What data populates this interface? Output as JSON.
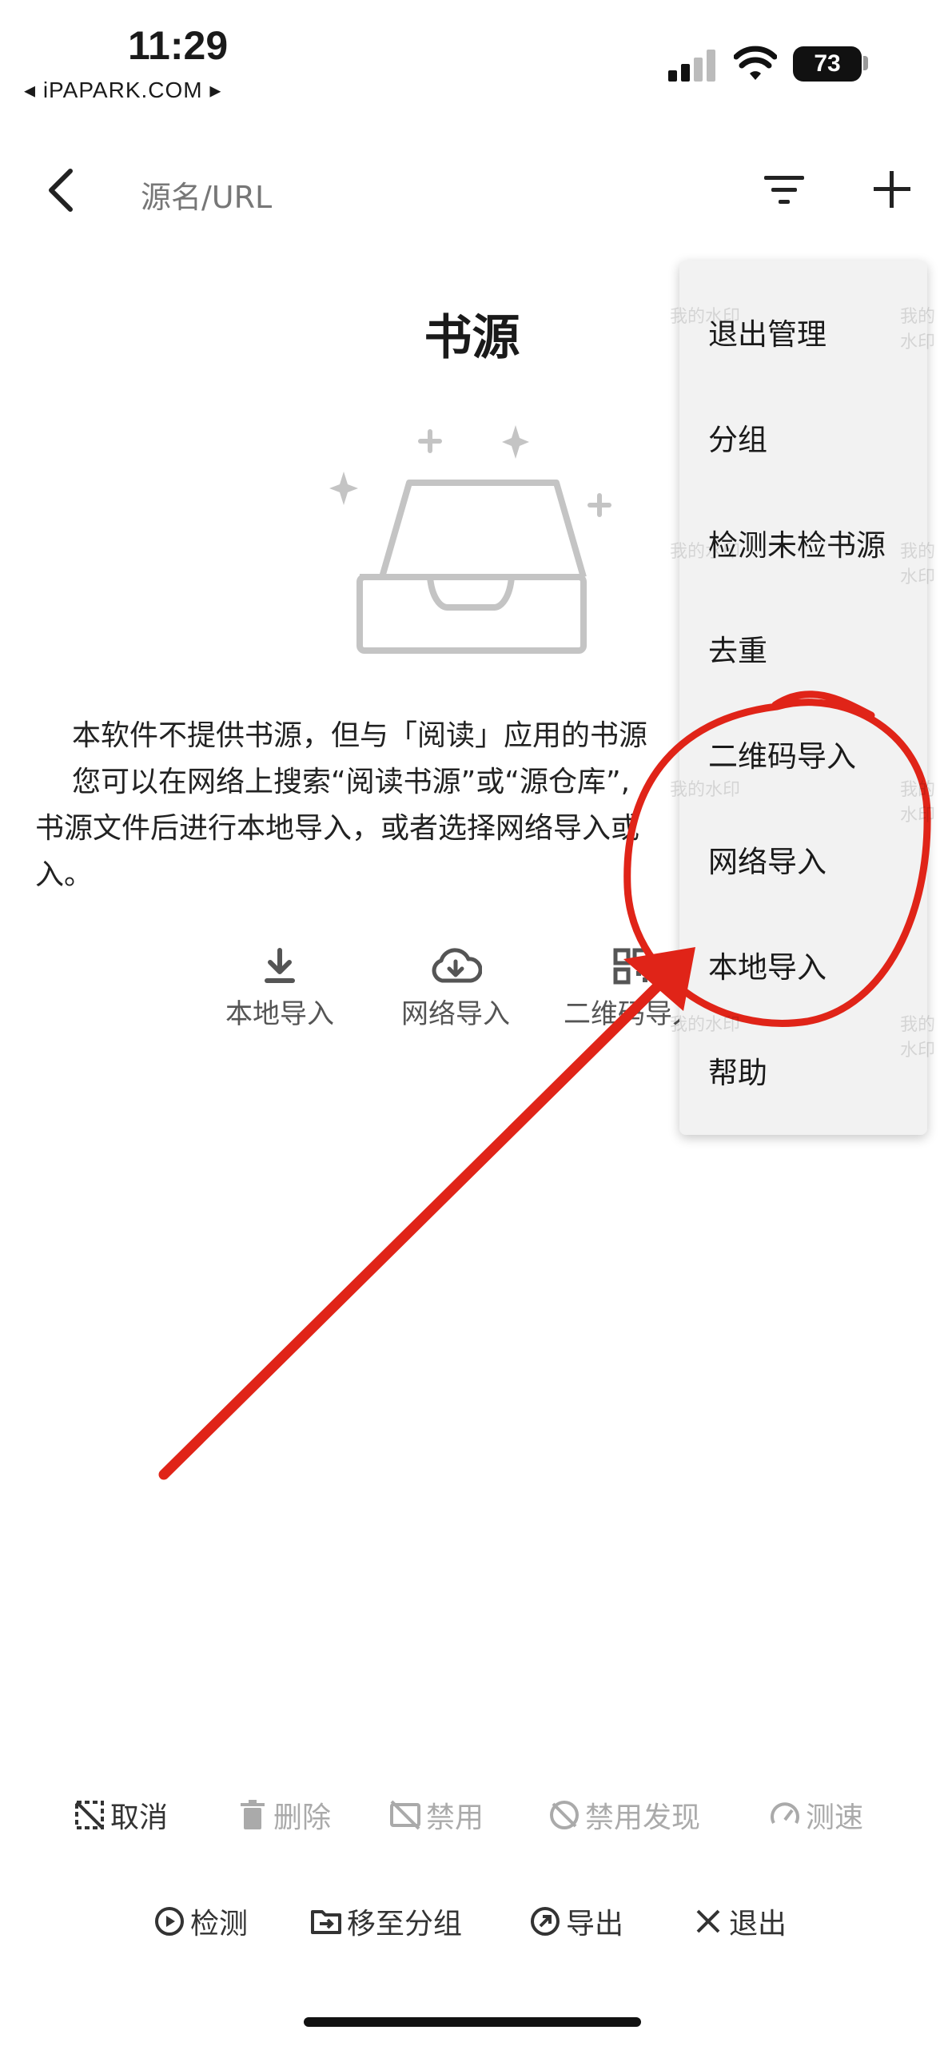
{
  "status_bar": {
    "time": "11:29",
    "carrier": "◂ iPAPARK.COM ▸",
    "battery": "73"
  },
  "top_bar": {
    "search_placeholder": "源名/URL",
    "back_icon": "chevron-left-icon",
    "filter_icon": "filter-icon",
    "add_icon": "plus-icon"
  },
  "empty_state": {
    "title": "书源",
    "description_lines": [
      "本软件不提供书源，但与「阅读」应用的书源",
      "您可以在网络上搜索“阅读书源”或“源仓库”,",
      "书源文件后进行本地导入，或者选择网络导入或",
      "入。"
    ],
    "actions": [
      {
        "label": "本地导入",
        "icon": "download-icon"
      },
      {
        "label": "网络导入",
        "icon": "cloud-download-icon"
      },
      {
        "label": "二维码导入",
        "icon": "qrcode-icon"
      }
    ]
  },
  "menu": {
    "items": [
      "退出管理",
      "分组",
      "检测未检书源",
      "去重",
      "二维码导入",
      "网络导入",
      "本地导入",
      "帮助"
    ]
  },
  "bottom_toolbar": {
    "row1": [
      {
        "label": "取消",
        "icon": "select-cancel-icon",
        "enabled": true
      },
      {
        "label": "删除",
        "icon": "trash-icon",
        "enabled": false
      },
      {
        "label": "禁用",
        "icon": "disable-icon",
        "enabled": false
      },
      {
        "label": "禁用发现",
        "icon": "explore-off-icon",
        "enabled": false
      },
      {
        "label": "测速",
        "icon": "speed-icon",
        "enabled": false
      }
    ],
    "row2": [
      {
        "label": "检测",
        "icon": "play-circle-icon",
        "enabled": true
      },
      {
        "label": "移至分组",
        "icon": "folder-move-icon",
        "enabled": true
      },
      {
        "label": "导出",
        "icon": "export-icon",
        "enabled": true
      },
      {
        "label": "退出",
        "icon": "close-icon",
        "enabled": true
      }
    ]
  },
  "watermark": "我的水印",
  "colors": {
    "annotation_red": "#e02418",
    "menu_bg": "#f2f2f2",
    "disabled_text": "#aaaaaa"
  }
}
